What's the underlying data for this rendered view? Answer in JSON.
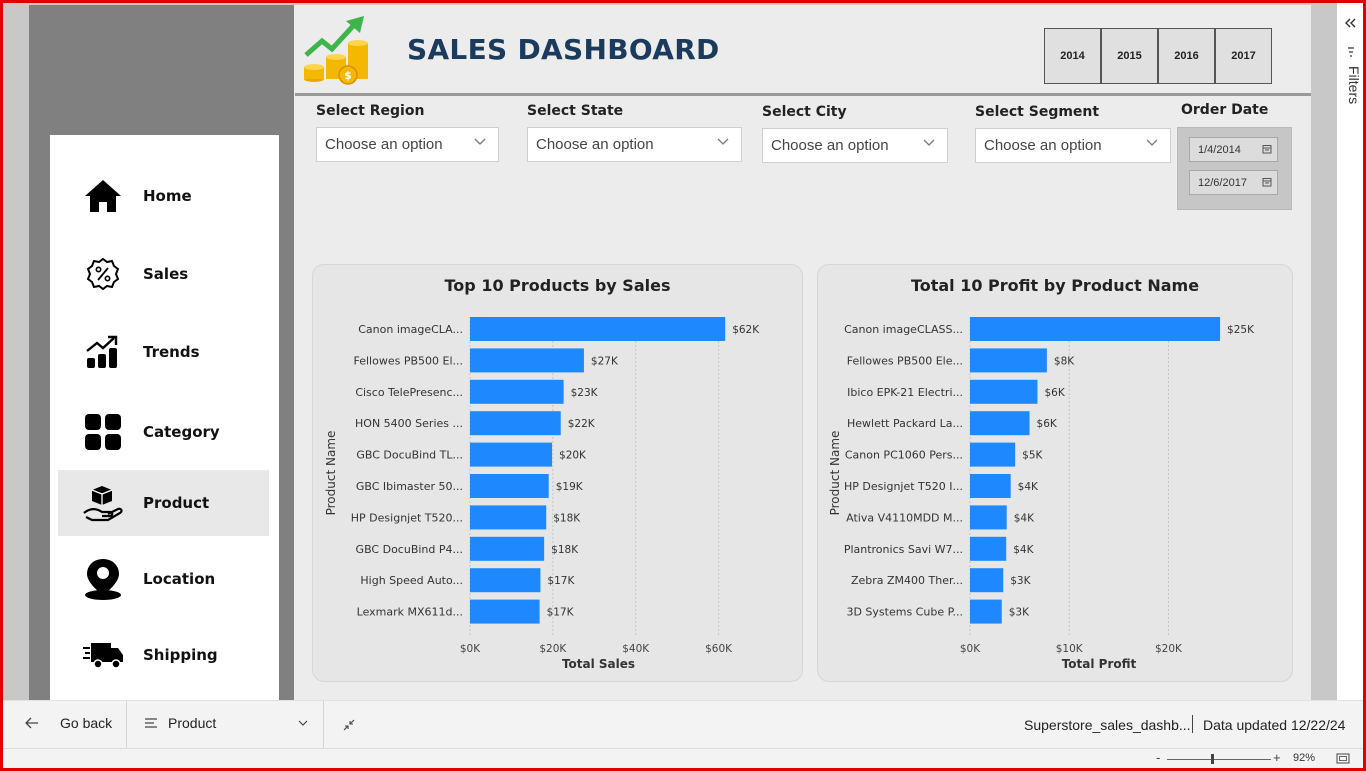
{
  "header": {
    "title": "SALES DASHBOARD"
  },
  "years": [
    "2014",
    "2015",
    "2016",
    "2017"
  ],
  "nav": [
    {
      "label": "Home",
      "icon": "home-icon"
    },
    {
      "label": "Sales",
      "icon": "percent-badge-icon"
    },
    {
      "label": "Trends",
      "icon": "trend-chart-icon"
    },
    {
      "label": "Category",
      "icon": "grid-icon"
    },
    {
      "label": "Product",
      "icon": "product-hand-icon",
      "active": true
    },
    {
      "label": "Location",
      "icon": "location-pin-icon"
    },
    {
      "label": "Shipping",
      "icon": "truck-icon"
    }
  ],
  "slicers": {
    "region": {
      "label": "Select Region",
      "value": "Choose an option"
    },
    "state": {
      "label": "Select State",
      "value": "Choose an option"
    },
    "city": {
      "label": "Select City",
      "value": "Choose an option"
    },
    "segment": {
      "label": "Select Segment",
      "value": "Choose an option"
    },
    "order_date": {
      "label": "Order Date",
      "start": "1/4/2014",
      "end": "12/6/2017"
    }
  },
  "filters_pane": {
    "label": "Filters"
  },
  "bottom": {
    "go_back": "Go back",
    "page_select": "Product",
    "file_name": "Superstore_sales_dashb...",
    "data_updated": "Data updated 12/22/24",
    "zoom": "92%"
  },
  "colors": {
    "bar": "#1e88ff",
    "title": "#1b3a5c",
    "frame": "#e00000"
  },
  "chart_data": [
    {
      "type": "bar",
      "orientation": "horizontal",
      "title": "Top 10 Products by Sales",
      "xlabel": "Total Sales",
      "ylabel": "Product Name",
      "categories": [
        "Canon imageCLA...",
        "Fellowes PB500 El...",
        "Cisco TelePresenc...",
        "HON 5400 Series ...",
        "GBC DocuBind TL...",
        "GBC Ibimaster 50...",
        "HP Designjet T520...",
        "GBC DocuBind P4...",
        "High Speed Auto...",
        "Lexmark MX611d..."
      ],
      "values": [
        61600,
        27500,
        22600,
        21900,
        19800,
        19000,
        18400,
        17900,
        17000,
        16800
      ],
      "data_labels": [
        "$62K",
        "$27K",
        "$23K",
        "$22K",
        "$20K",
        "$19K",
        "$18K",
        "$18K",
        "$17K",
        "$17K"
      ],
      "xticks": [
        "$0K",
        "$20K",
        "$40K",
        "$60K"
      ],
      "xlim": [
        0,
        63000
      ],
      "grid": true
    },
    {
      "type": "bar",
      "orientation": "horizontal",
      "title": "Total 10 Profit by Product Name",
      "xlabel": "Total Profit",
      "ylabel": "Product Name",
      "categories": [
        "Canon imageCLASS...",
        "Fellowes PB500 Ele...",
        "Ibico EPK-21 Electri...",
        "Hewlett Packard La...",
        "Canon PC1060 Pers...",
        "HP Designjet T520 I...",
        "Ativa V4110MDD M...",
        "Plantronics Savi W7...",
        "Zebra ZM400 Ther...",
        "3D Systems Cube P..."
      ],
      "values": [
        25200,
        7750,
        6800,
        6000,
        4550,
        4100,
        3700,
        3650,
        3350,
        3200
      ],
      "data_labels": [
        "$25K",
        "$8K",
        "$6K",
        "$6K",
        "$5K",
        "$4K",
        "$4K",
        "$4K",
        "$3K",
        "$3K"
      ],
      "xticks": [
        "$0K",
        "$10K",
        "$20K"
      ],
      "xlim": [
        0,
        26000
      ],
      "grid": true
    }
  ]
}
